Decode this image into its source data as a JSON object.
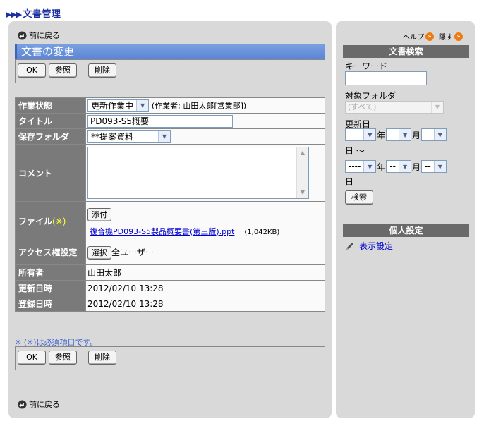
{
  "app_title": "文書管理",
  "app_arrows": "▶▶▶",
  "back_label": "前に戻る",
  "page_heading": "文書の変更",
  "buttons": {
    "ok": "OK",
    "browse": "参照",
    "delete": "削除"
  },
  "form": {
    "status": {
      "label": "作業状態",
      "value": "更新作業中",
      "note": "(作業者: 山田太郎[営業部])"
    },
    "title": {
      "label": "タイトル",
      "value": "PD093-S5概要"
    },
    "folder": {
      "label": "保存フォルダ",
      "value": "**提案資料"
    },
    "comment": {
      "label": "コメント",
      "value": ""
    },
    "file": {
      "label": "ファイル",
      "required_mark": "(※)",
      "attach_label": "添付",
      "file_name": "複合機PD093-S5製品概要書(第三版).ppt",
      "file_size": "(1,042KB)"
    },
    "access": {
      "label": "アクセス権設定",
      "select_label": "選択",
      "value": "全ユーザー"
    },
    "owner": {
      "label": "所有者",
      "value": "山田太郎"
    },
    "updated": {
      "label": "更新日時",
      "value": "2012/02/10 13:28"
    },
    "registered": {
      "label": "登録日時",
      "value": "2012/02/10 13:28"
    }
  },
  "required_note": "※ (※)は必須項目です。",
  "side": {
    "help_label": "ヘルプ",
    "hide_label": "隠す",
    "search_header": "文書検索",
    "keyword_label": "キーワード",
    "keyword_value": "",
    "folder_label": "対象フォルダ",
    "folder_value": "(すべて)",
    "date_label": "更新日",
    "year_value": "----",
    "month_value": "--",
    "day_value": "--",
    "year_unit": "年",
    "month_unit": "月",
    "day_unit": "日",
    "tilde": "日 ～",
    "search_button": "検索",
    "personal_header": "個人設定",
    "display_settings": "表示設定"
  },
  "colors": {
    "title_blue": "#1a2fa0",
    "heading_blue": "#6b93dc",
    "label_gray": "#7a7a7a",
    "link": "#0000cc",
    "help_orange": "#f07a10"
  }
}
